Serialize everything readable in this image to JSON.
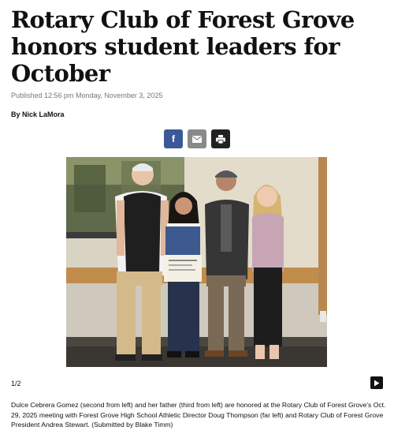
{
  "article": {
    "headline": "Rotary Club of Forest Grove honors student leaders for October",
    "published": "Published 12:56 pm Monday, November 3, 2025",
    "byline": "By Nick LaMora"
  },
  "share": {
    "buttons": [
      {
        "icon": "facebook-icon",
        "glyph": "f",
        "color": "#3b5998"
      },
      {
        "icon": "email-icon",
        "color": "#8a8a8a"
      },
      {
        "icon": "print-icon",
        "color": "#222222"
      }
    ]
  },
  "gallery": {
    "counter": "1/2",
    "next_icon": "play-next-icon",
    "caption": "Dulce Cebrera Gomez (second from left) and her father (third from left) are honored at the Rotary Club of Forest Grove's Oct. 29, 2025 meeting with Forest Grove High School Athletic Director Doug Thompson (far left) and Rotary Club of Forest Grove President Andrea Stewart. (Submitted by Blake Timm)"
  }
}
